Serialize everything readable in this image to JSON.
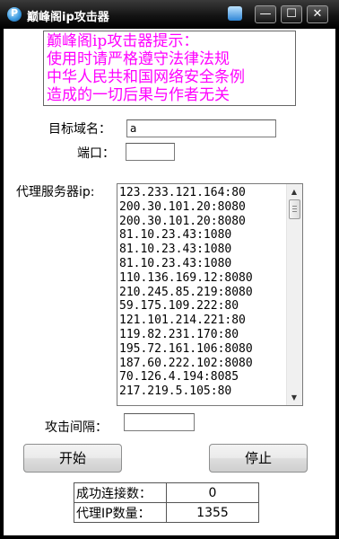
{
  "window": {
    "title": "巅峰阁ip攻击器",
    "minimize_glyph": "—",
    "maximize_glyph": "☐",
    "close_glyph": "✕"
  },
  "notice": {
    "lines": [
      "巅峰阁ip攻击器提示：",
      "使用时请严格遵守法律法规",
      "中华人民共和国网络安全条例",
      "造成的一切后果与作者无关"
    ],
    "color": "#ff00ff"
  },
  "form": {
    "domain_label": "目标域名：",
    "domain_value": "a",
    "port_label": "端口：",
    "port_value": "",
    "proxy_label": "代理服务器ip:",
    "proxy_list": [
      "123.233.121.164:80",
      "200.30.101.20:8080",
      "200.30.101.20:8080",
      "81.10.23.43:1080",
      "81.10.23.43:1080",
      "81.10.23.43:1080",
      "110.136.169.12:8080",
      "210.245.85.219:8080",
      "59.175.109.222:80",
      "121.101.214.221:80",
      "119.82.231.170:80",
      "195.72.161.106:8080",
      "187.60.222.102:8080",
      "70.126.4.194:8085",
      "217.219.5.105:80"
    ],
    "interval_label": "攻击间隔：",
    "interval_value": ""
  },
  "buttons": {
    "start_label": "开始",
    "stop_label": "停止"
  },
  "stats": {
    "success_label": "成功连接数：",
    "success_value": "0",
    "proxy_count_label": "代理IP数量：",
    "proxy_count_value": "1355"
  }
}
